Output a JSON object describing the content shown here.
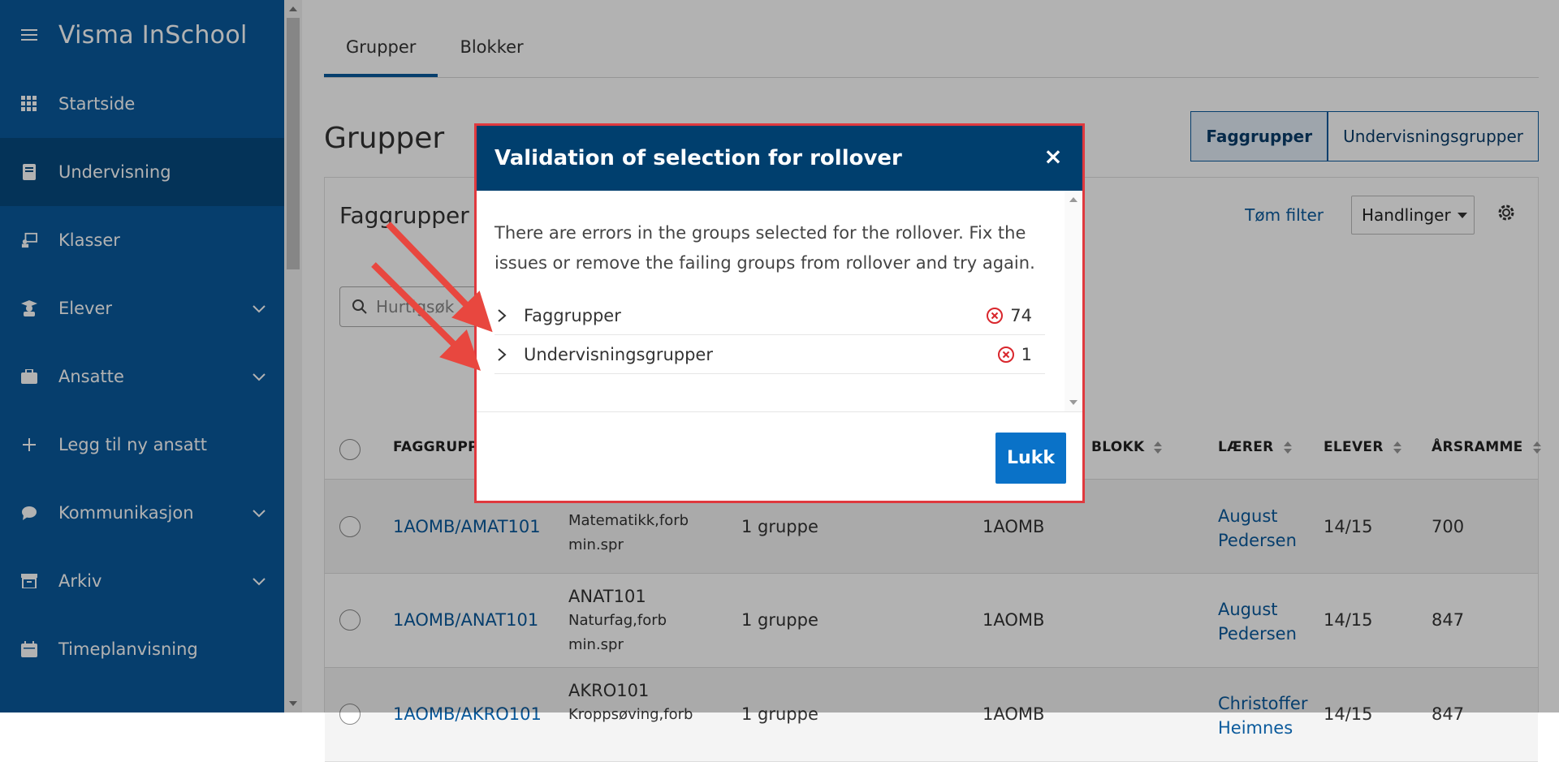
{
  "app": {
    "title": "Visma InSchool"
  },
  "sidebar": {
    "items": [
      {
        "label": "Startside",
        "icon": "grid-icon"
      },
      {
        "label": "Undervisning",
        "icon": "book-icon",
        "active": true
      },
      {
        "label": "Klasser",
        "icon": "classroom-icon"
      },
      {
        "label": "Elever",
        "icon": "student-icon",
        "expandable": true
      },
      {
        "label": "Ansatte",
        "icon": "briefcase-icon",
        "expandable": true
      },
      {
        "label": "Legg til ny ansatt",
        "icon": "plus-icon"
      },
      {
        "label": "Kommunikasjon",
        "icon": "chat-icon",
        "expandable": true
      },
      {
        "label": "Arkiv",
        "icon": "archive-icon",
        "expandable": true
      },
      {
        "label": "Timeplanvisning",
        "icon": "calendar-icon"
      }
    ]
  },
  "tabs": [
    {
      "label": "Grupper",
      "active": true
    },
    {
      "label": "Blokker"
    }
  ],
  "page": {
    "title": "Grupper",
    "segment": [
      {
        "label": "Faggrupper",
        "active": true
      },
      {
        "label": "Undervisningsgrupper"
      }
    ]
  },
  "card": {
    "title": "Faggrupper",
    "clear_filter": "Tøm filter",
    "actions": "Handlinger",
    "search_placeholder": "Hurtigsøk"
  },
  "table": {
    "headers": [
      "FAGGRUPPE",
      "BLOKK",
      "LÆRER",
      "ELEVER",
      "ÅRSRAMME"
    ],
    "rows": [
      {
        "group": "1AOMB/AMAT101",
        "code": "",
        "subject1": "Matematikk,forb",
        "subject2": "min.spr",
        "groups": "1 gruppe",
        "class": "1AOMB",
        "teacher1": "August",
        "teacher2": "Pedersen",
        "students": "14/15",
        "hours": "700"
      },
      {
        "group": "1AOMB/ANAT101",
        "code": "ANAT101",
        "subject1": "Naturfag,forb",
        "subject2": "min.spr",
        "groups": "1 gruppe",
        "class": "1AOMB",
        "teacher1": "August",
        "teacher2": "Pedersen",
        "students": "14/15",
        "hours": "847"
      },
      {
        "group": "1AOMB/AKRO101",
        "code": "AKRO101",
        "subject1": "Kroppsøving,forb",
        "subject2": "",
        "groups": "1 gruppe",
        "class": "1AOMB",
        "teacher1": "Christoffer",
        "teacher2": "Heimnes",
        "students": "14/15",
        "hours": "847"
      }
    ]
  },
  "modal": {
    "title": "Validation of selection for rollover",
    "close_glyph": "×",
    "message": "There are errors in the groups selected for the rollover. Fix the issues or remove the failing groups from rollover and try again.",
    "items": [
      {
        "label": "Faggrupper",
        "count": "74"
      },
      {
        "label": "Undervisningsgrupper",
        "count": "1"
      }
    ],
    "button": "Lukk",
    "error_color": "#d9262c"
  },
  "annotation": {
    "arrow_color": "#e8473f"
  }
}
